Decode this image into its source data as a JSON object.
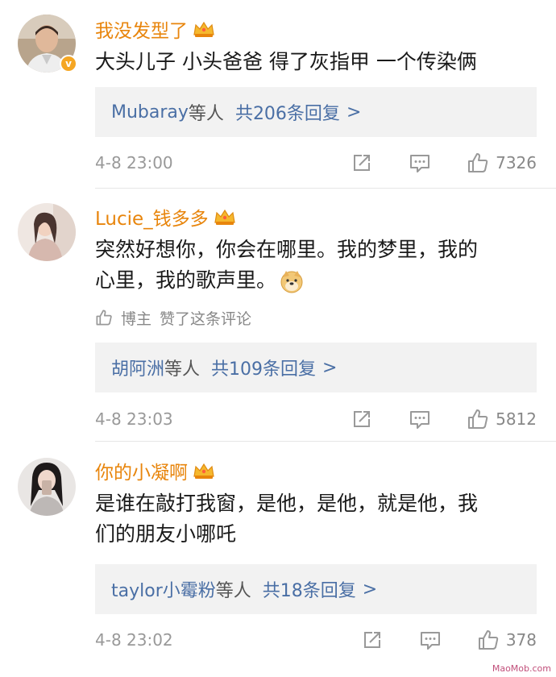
{
  "comments": [
    {
      "username": "我没发型了",
      "text": "大头儿子 小头爸爸 得了灰指甲 一个传染俩",
      "reply_users": "Mubaray",
      "reply_etc": "等人",
      "reply_count": "共206条回复",
      "reply_arrow": ">",
      "time": "4-8 23:00",
      "likes": "7326",
      "verified": "v"
    },
    {
      "username": "Lucie_钱多多",
      "text_line1": "突然好想你，你会在哪里。我的梦里，我的",
      "text_line2": "心里，我的歌声里。",
      "liked_by": "博主",
      "liked_text": "赞了这条评论",
      "reply_users": "胡阿洲",
      "reply_etc": "等人",
      "reply_count": "共109条回复",
      "reply_arrow": ">",
      "time": "4-8 23:03",
      "likes": "5812"
    },
    {
      "username": "你的小凝啊",
      "text_line1": "是谁在敲打我窗，是他，是他，就是他，我",
      "text_line2": "们的朋友小哪吒",
      "reply_users": "taylor小霉粉",
      "reply_etc": "等人",
      "reply_count": "共18条回复",
      "reply_arrow": ">",
      "time": "4-8 23:02",
      "likes": "378"
    }
  ],
  "colors": {
    "username": "#e8850c",
    "link": "#4a6fa5",
    "meta": "#999999",
    "reply_bg": "#f2f2f2"
  },
  "watermark": "MaoMob.com"
}
